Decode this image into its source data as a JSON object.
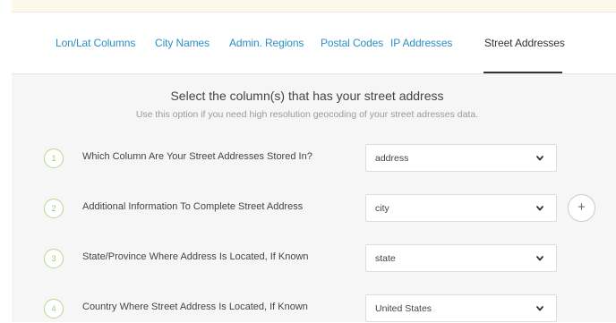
{
  "tabs": [
    {
      "label": "Lon/Lat Columns",
      "active": false
    },
    {
      "label": "City Names",
      "active": false
    },
    {
      "label": "Admin. Regions",
      "active": false
    },
    {
      "label": "Postal Codes",
      "active": false
    },
    {
      "label": "IP Addresses",
      "active": false
    },
    {
      "label": "Street Addresses",
      "active": true
    }
  ],
  "section": {
    "title": "Select the column(s) that has your street address",
    "subtitle": "Use this option if you need high resolution geocoding of your street adresses data."
  },
  "steps": [
    {
      "number": "1",
      "label": "Which Column Are Your Street Addresses Stored In?",
      "selected": "address"
    },
    {
      "number": "2",
      "label": "Additional Information To Complete Street Address",
      "selected": "city"
    },
    {
      "number": "3",
      "label": "State/Province Where Address Is Located, If Known",
      "selected": "state"
    },
    {
      "number": "4",
      "label": "Country Where Street Address Is Located, If Known",
      "selected": "United States"
    }
  ],
  "add_button_symbol": "+",
  "colors": {
    "tab_link": "#2b8fc4",
    "tab_active": "#333333",
    "step_circle": "#b9d58c",
    "content_bg": "#f6f6f6"
  },
  "icons": {
    "select_arrow": "chevron-down-icon",
    "add": "plus-icon"
  }
}
